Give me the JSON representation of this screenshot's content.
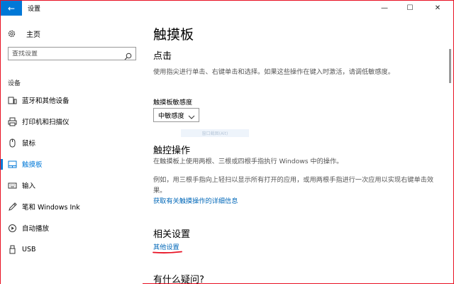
{
  "window": {
    "title": "设置",
    "back_glyph": "←",
    "controls": {
      "minimize": "—",
      "maximize": "☐",
      "close": "✕"
    }
  },
  "sidebar": {
    "home_label": "主页",
    "search_placeholder": "查找设置",
    "section_label": "设备",
    "items": [
      {
        "label": "蓝牙和其他设备",
        "icon": "bluetooth-devices-icon"
      },
      {
        "label": "打印机和扫描仪",
        "icon": "printer-icon"
      },
      {
        "label": "鼠标",
        "icon": "mouse-icon"
      },
      {
        "label": "触摸板",
        "icon": "touchpad-icon",
        "active": true
      },
      {
        "label": "输入",
        "icon": "keyboard-icon"
      },
      {
        "label": "笔和 Windows Ink",
        "icon": "pen-icon"
      },
      {
        "label": "自动播放",
        "icon": "autoplay-icon"
      },
      {
        "label": "USB",
        "icon": "usb-icon"
      }
    ]
  },
  "main": {
    "title": "触摸板",
    "tap": {
      "heading": "点击",
      "description": "使用指尖进行单击、右键单击和选择。如果这些操作在键入时激活，请调低敏感度。",
      "sensitivity_label": "触摸板敏感度",
      "sensitivity_value": "中敏感度"
    },
    "faded_text": "窗口截图(Alt)",
    "gestures": {
      "heading": "触控操作",
      "description": "在触摸板上使用两根、三根或四根手指执行 Windows 中的操作。",
      "example": "例如，用三根手指向上轻扫以显示所有打开的应用，或用两根手指进行一次应用以实现右键单击效果。",
      "link": "获取有关触摸操作的详细信息"
    },
    "related": {
      "heading": "相关设置",
      "link": "其他设置"
    },
    "questions": {
      "heading": "有什么疑问?"
    }
  },
  "colors": {
    "accent": "#0078d7",
    "link": "#0067b8",
    "annotation": "#e81123"
  }
}
